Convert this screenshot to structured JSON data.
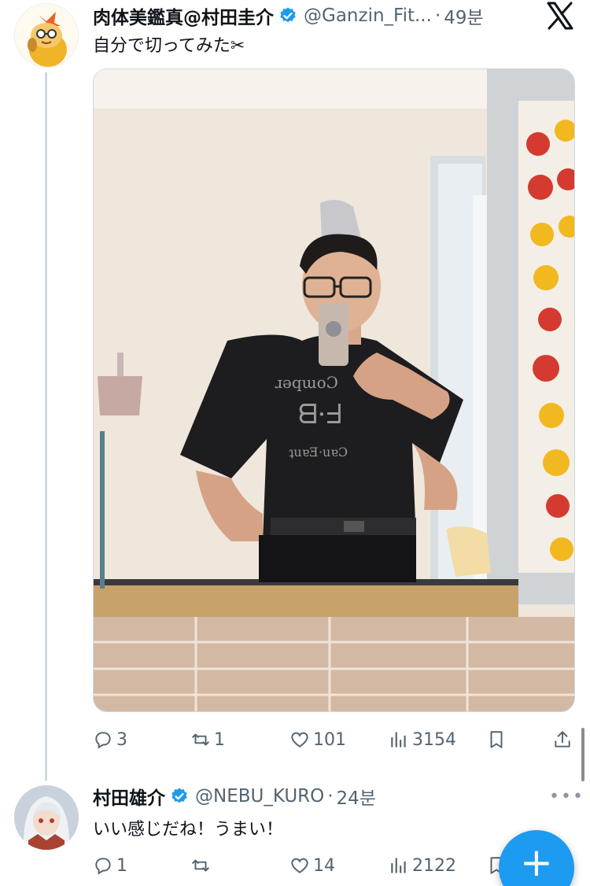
{
  "tweet1": {
    "display_name": "肉体美鑑真@村田圭介",
    "handle": "@Ganzin_Fit...",
    "separator": "·",
    "time": "49분",
    "text": "自分で切ってみた✂",
    "avatar_icon": "shrimp-mascot-avatar",
    "verified_color": "#1d9bf0",
    "actions": {
      "replies": "3",
      "reposts": "1",
      "likes": "101",
      "views": "3154"
    }
  },
  "tweet2": {
    "display_name": "村田雄介",
    "handle": "@NEBU_KURO",
    "separator": "·",
    "time": "24분",
    "text": "いい感じだね！うまい！",
    "avatar_icon": "anime-character-avatar",
    "actions": {
      "replies": "1",
      "reposts": "",
      "likes": "14",
      "views": "2122"
    }
  },
  "more_label": "•••",
  "fab_label": "+",
  "colors": {
    "accent": "#1d9bf0",
    "muted": "#536471",
    "text": "#0f1419",
    "thread": "#cfd9de"
  },
  "icons": [
    "x-logo-icon",
    "verified-badge-icon",
    "reply-icon",
    "repost-icon",
    "like-icon",
    "views-icon",
    "bookmark-icon",
    "share-icon",
    "more-icon",
    "plus-icon"
  ]
}
